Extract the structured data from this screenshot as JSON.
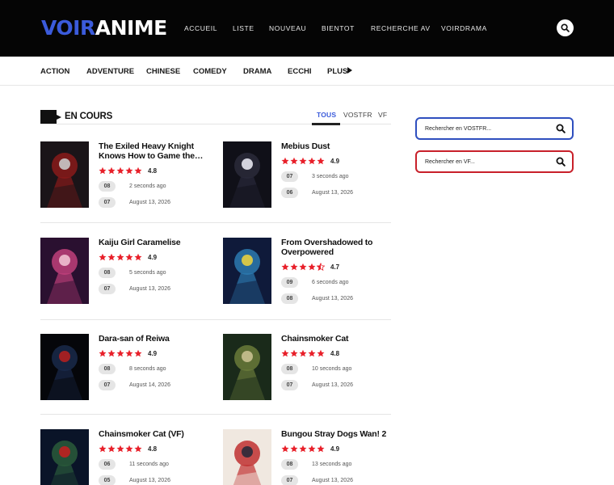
{
  "header": {
    "logo_part1": "VOIR",
    "logo_part2": "ANIME",
    "nav": [
      "ACCUEIL",
      "LISTE",
      "NOUVEAU",
      "BIENTOT",
      "RECHERCHE AV",
      "VOIRDRAMA"
    ],
    "search_icon": "search-icon"
  },
  "categories": {
    "items": [
      "ACTION",
      "ADVENTURE",
      "CHINESE",
      "COMEDY",
      "DRAMA",
      "ECCHI"
    ],
    "more_label": "PLUS"
  },
  "section": {
    "title": "EN COURS",
    "tabs": [
      "TOUS",
      "VOSTFR",
      "VF"
    ],
    "active_tab": "TOUS"
  },
  "items": [
    {
      "title": "The Exiled Heavy Knight Knows How to Game the…",
      "rating": "4.8",
      "stars": 5,
      "episodes": [
        {
          "ep": "08",
          "time": "2 seconds ago"
        },
        {
          "ep": "07",
          "time": "August 13, 2026"
        }
      ]
    },
    {
      "title": "Mebius Dust",
      "rating": "4.9",
      "stars": 5,
      "episodes": [
        {
          "ep": "07",
          "time": "3 seconds ago"
        },
        {
          "ep": "06",
          "time": "August 13, 2026"
        }
      ]
    },
    {
      "title": "Kaiju Girl Caramelise",
      "rating": "4.9",
      "stars": 5,
      "episodes": [
        {
          "ep": "08",
          "time": "5 seconds ago"
        },
        {
          "ep": "07",
          "time": "August 13, 2026"
        }
      ]
    },
    {
      "title": "From Overshadowed to Overpowered",
      "rating": "4.7",
      "stars": 4.5,
      "episodes": [
        {
          "ep": "09",
          "time": "6 seconds ago"
        },
        {
          "ep": "08",
          "time": "August 13, 2026"
        }
      ]
    },
    {
      "title": "Dara-san of Reiwa",
      "rating": "4.9",
      "stars": 5,
      "episodes": [
        {
          "ep": "08",
          "time": "8 seconds ago"
        },
        {
          "ep": "07",
          "time": "August 14, 2026"
        }
      ]
    },
    {
      "title": "Chainsmoker Cat",
      "rating": "4.8",
      "stars": 5,
      "episodes": [
        {
          "ep": "08",
          "time": "10 seconds ago"
        },
        {
          "ep": "07",
          "time": "August 13, 2026"
        }
      ]
    },
    {
      "title": "Chainsmoker Cat (VF)",
      "rating": "4.8",
      "stars": 5,
      "episodes": [
        {
          "ep": "06",
          "time": "11 seconds ago"
        },
        {
          "ep": "05",
          "time": "August 13, 2026"
        }
      ]
    },
    {
      "title": "Bungou Stray Dogs Wan! 2",
      "rating": "4.9",
      "stars": 5,
      "episodes": [
        {
          "ep": "08",
          "time": "13 seconds ago"
        },
        {
          "ep": "07",
          "time": "August 13, 2026"
        }
      ]
    }
  ],
  "sidebar": {
    "search_vostfr_placeholder": "Rechercher en VOSTFR...",
    "search_vf_placeholder": "Rechercher en VF..."
  },
  "colors": {
    "accent": "#3b5bdb",
    "vostfr_border": "#2f4fbf",
    "vf_border": "#c8202a",
    "star": "#e8202a",
    "header_bg": "#050505"
  }
}
